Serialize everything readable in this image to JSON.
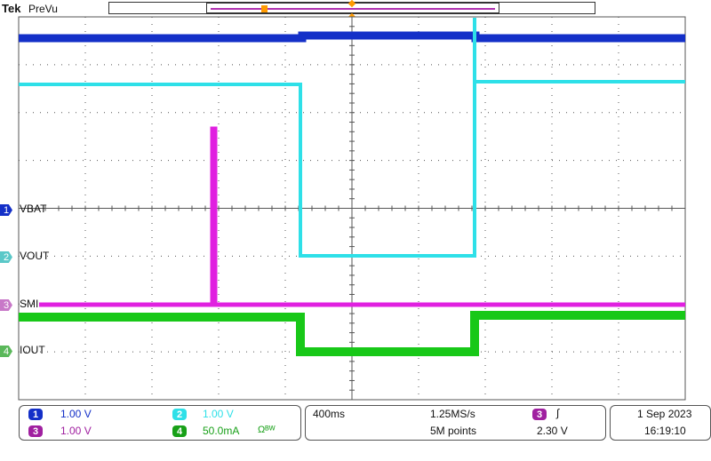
{
  "header": {
    "logo": "Tek",
    "mode": "PreVu"
  },
  "colors": {
    "ch1": "#1430c8",
    "ch2": "#2ee0e8",
    "ch3": "#e020e0",
    "ch4": "#18c818",
    "trigger": "#ff9a00",
    "grid": "#555555"
  },
  "channels": [
    {
      "num": "1",
      "label": "VBAT"
    },
    {
      "num": "2",
      "label": "VOUT"
    },
    {
      "num": "3",
      "label": "SMI"
    },
    {
      "num": "4",
      "label": "IOUT"
    }
  ],
  "status": {
    "ch1_scale": "1.00 V",
    "ch2_scale": "1.00 V",
    "ch3_scale": "1.00 V",
    "ch4_scale": "50.0mA",
    "ch4_extra": "Ωᴮᵂ",
    "timebase": "400ms",
    "sample_rate": "1.25MS/s",
    "record_length": "5M points",
    "trigger_source": "3",
    "trigger_slope": "∫",
    "trigger_level": "2.30 V",
    "date": "1 Sep  2023",
    "time": "16:19:10"
  }
}
